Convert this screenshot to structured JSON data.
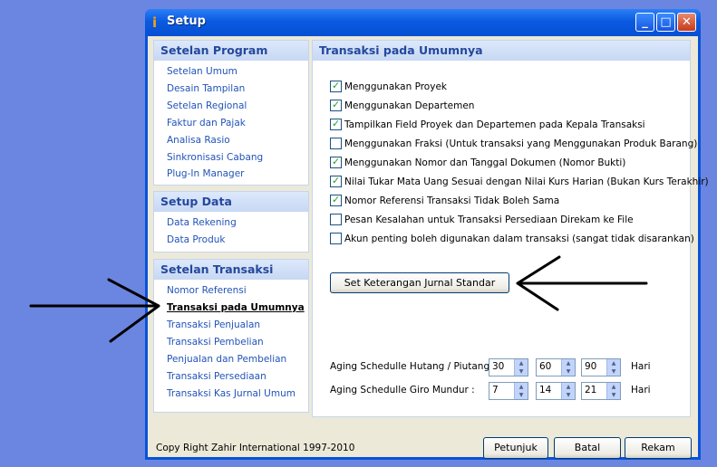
{
  "window": {
    "title": "Setup"
  },
  "groups": [
    {
      "title": "Setelan Program",
      "items": [
        "Setelan Umum",
        "Desain Tampilan",
        "Setelan Regional",
        "Faktur dan Pajak",
        "Analisa Rasio",
        "Sinkronisasi Cabang",
        "Plug-In Manager"
      ]
    },
    {
      "title": "Setup Data",
      "items": [
        "Data Rekening",
        "Data Produk"
      ]
    },
    {
      "title": "Setelan Transaksi",
      "items": [
        "Nomor Referensi",
        "Transaksi pada Umumnya",
        "Transaksi Penjualan",
        "Transaksi Pembelian",
        "Penjualan dan Pembelian",
        "Transaksi Persediaan",
        "Transaksi Kas Jurnal Umum"
      ],
      "active_index": 1
    }
  ],
  "main": {
    "title": "Transaksi pada Umumnya",
    "options": [
      {
        "label": "Menggunakan Proyek",
        "checked": true
      },
      {
        "label": "Menggunakan Departemen",
        "checked": true
      },
      {
        "label": "Tampilkan Field Proyek dan Departemen pada Kepala Transaksi",
        "checked": true
      },
      {
        "label": "Menggunakan Fraksi (Untuk transaksi yang Menggunakan Produk Barang)",
        "checked": false
      },
      {
        "label": "Menggunakan Nomor dan Tanggal Dokumen (Nomor Bukti)",
        "checked": true
      },
      {
        "label": "Nilai Tukar Mata Uang Sesuai dengan Nilai Kurs Harian (Bukan Kurs Terakhir)",
        "checked": true
      },
      {
        "label": "Nomor Referensi Transaksi Tidak Boleh Sama",
        "checked": true
      },
      {
        "label": "Pesan Kesalahan untuk Transaksi Persediaan Direkam ke File",
        "checked": false
      },
      {
        "label": "Akun penting boleh digunakan dalam transaksi (sangat tidak disarankan)",
        "checked": false
      }
    ],
    "journal_button": "Set Keterangan Jurnal Standar",
    "aging_hutang_label": "Aging Schedulle Hutang / Piutang  :",
    "aging_hutang": [
      "30",
      "60",
      "90"
    ],
    "aging_giro_label": "Aging Schedulle Giro Mundur  :",
    "aging_giro": [
      "7",
      "14",
      "21"
    ],
    "unit": "Hari"
  },
  "footer": {
    "copyright": "Copy Right Zahir International 1997-2010",
    "help": "Petunjuk",
    "cancel": "Batal",
    "save": "Rekam"
  }
}
